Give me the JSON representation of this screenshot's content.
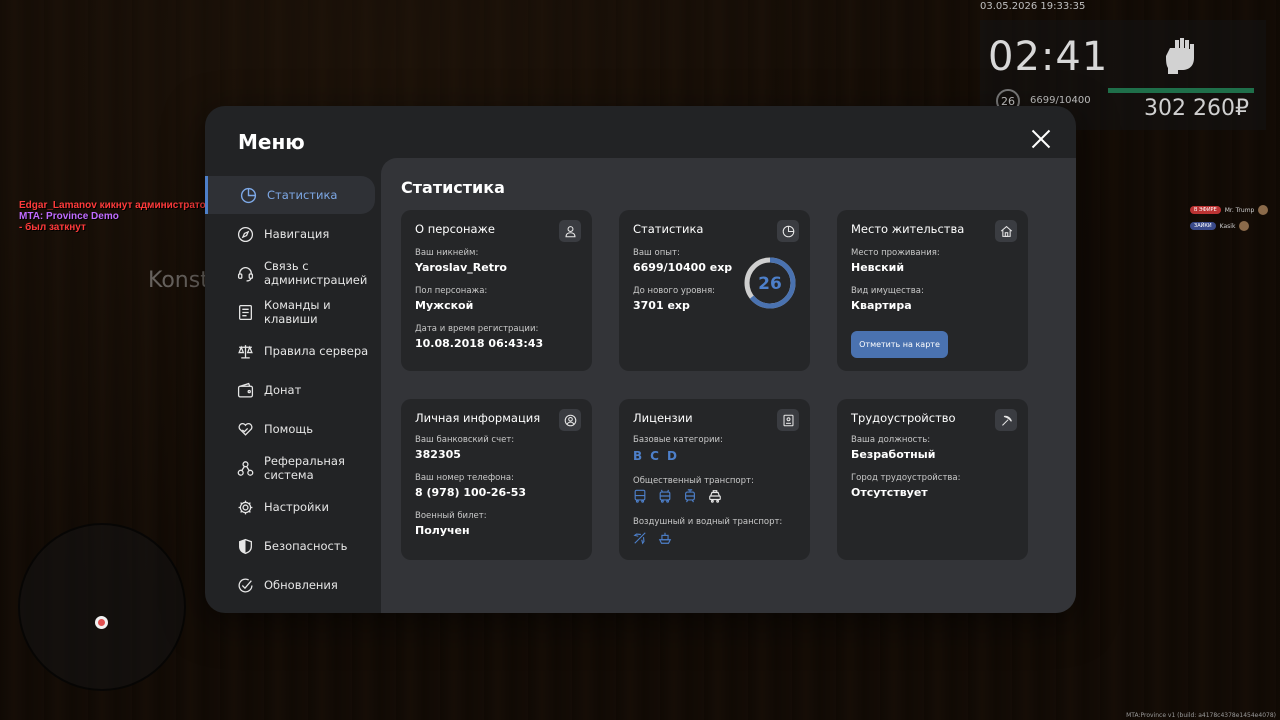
{
  "hud": {
    "datetime": "03.05.2026 19:33:35",
    "time": "02:41",
    "level": "26",
    "exp": "6699/10400",
    "money": "302 260₽",
    "health_fraction": 1.0
  },
  "chat": {
    "lines": [
      "Edgar_Lamanov кикнут администратором Veyhar_Halyardsen (AFK)",
      "MTA: Province Demo",
      "- был заткнут"
    ]
  },
  "world": {
    "nametag": "Konst"
  },
  "voice": {
    "rows": [
      {
        "badge": "В ЭФИРЕ",
        "name": "Mr. Trump"
      },
      {
        "badge": "ЗАЙКИ",
        "name": "Kasik"
      }
    ]
  },
  "build_info": "MTA:Province v1 (build: a4178c4378e1454e4078)",
  "menu": {
    "title": "Меню",
    "sidebar": [
      {
        "label": "Статистика",
        "icon": "pie-chart-icon",
        "active": true
      },
      {
        "label": "Навигация",
        "icon": "compass-icon"
      },
      {
        "label": "Связь с администрацией",
        "icon": "headset-icon"
      },
      {
        "label": "Команды и клавиши",
        "icon": "keyboard-icon"
      },
      {
        "label": "Правила сервера",
        "icon": "scales-icon"
      },
      {
        "label": "Донат",
        "icon": "wallet-icon"
      },
      {
        "label": "Помощь",
        "icon": "heart-hand-icon"
      },
      {
        "label": "Реферальная система",
        "icon": "referral-icon"
      },
      {
        "label": "Настройки",
        "icon": "gear-icon"
      },
      {
        "label": "Безопасность",
        "icon": "shield-icon"
      },
      {
        "label": "Обновления",
        "icon": "check-circle-icon"
      }
    ],
    "content_title": "Статистика",
    "cards": {
      "character": {
        "title": "О персонаже",
        "nickname_label": "Ваш никнейм:",
        "nickname": "Yaroslav_Retro",
        "gender_label": "Пол персонажа:",
        "gender": "Мужской",
        "reg_label": "Дата и время регистрации:",
        "reg": "10.08.2018 06:43:43"
      },
      "stats": {
        "title": "Статистика",
        "exp_label": "Ваш опыт:",
        "exp": "6699/10400 exp",
        "next_label": "До нового уровня:",
        "next": "3701 exp",
        "level": "26",
        "progress": 0.644
      },
      "residence": {
        "title": "Место жительства",
        "place_label": "Место проживания:",
        "place": "Невский",
        "type_label": "Вид имущества:",
        "type": "Квартира",
        "button": "Отметить на карте"
      },
      "personal": {
        "title": "Личная информация",
        "bank_label": "Ваш банковский счет:",
        "bank": "382305",
        "phone_label": "Ваш номер телефона:",
        "phone": "8 (978) 100-26-53",
        "military_label": "Военный билет:",
        "military": "Получен"
      },
      "licenses": {
        "title": "Лицензии",
        "base_label": "Базовые категории:",
        "categories": [
          "B",
          "C",
          "D"
        ],
        "public_label": "Общественный транспорт:",
        "public_icons": [
          "bus-icon",
          "trolleybus-icon",
          "tram-icon",
          "taxi-icon"
        ],
        "air_label": "Воздушный и водный транспорт:",
        "air_icons": [
          "plane-icon",
          "boat-icon"
        ]
      },
      "job": {
        "title": "Трудоустройство",
        "position_label": "Ваша должность:",
        "position": "Безработный",
        "city_label": "Город трудоустройства:",
        "city": "Отсутствует"
      }
    }
  }
}
